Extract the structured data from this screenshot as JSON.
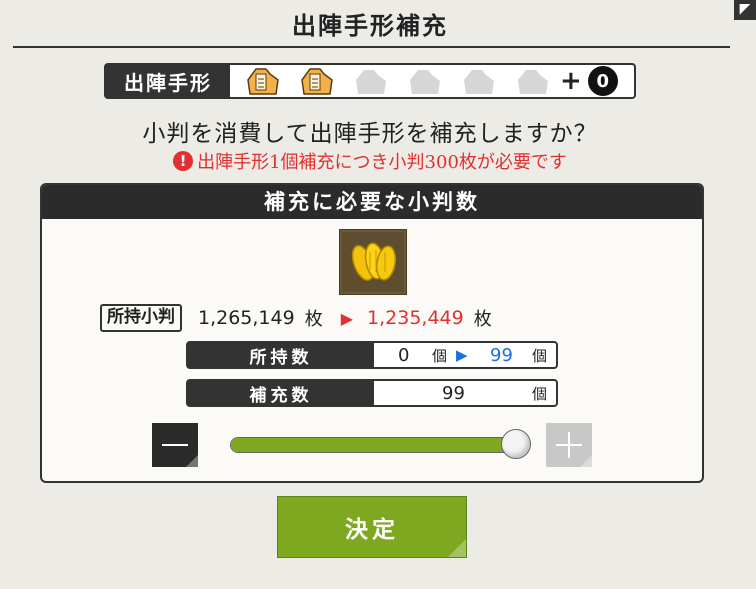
{
  "header": {
    "title": "出陣手形補充"
  },
  "pass_bar": {
    "label": "出陣手形",
    "slots": [
      {
        "icon": "pass-token-filled-icon",
        "filled": true
      },
      {
        "icon": "pass-token-filled-icon",
        "filled": true
      },
      {
        "icon": "pass-token-empty-icon",
        "filled": false
      },
      {
        "icon": "pass-token-empty-icon",
        "filled": false
      },
      {
        "icon": "pass-token-empty-icon",
        "filled": false
      },
      {
        "icon": "pass-token-empty-icon",
        "filled": false
      }
    ],
    "plus": "+",
    "extra_count": "0"
  },
  "question": "小判を消費して出陣手形を補充しますか？",
  "warning": {
    "icon": "!",
    "text": "出陣手形1個補充につき小判300枚が必要です"
  },
  "panel": {
    "title": "補充に必要な小判数",
    "item_icon": "koban-gold-coins-icon",
    "owned_koban": {
      "label": "所持小判",
      "current": "1,265,149",
      "unit": "枚",
      "after": "1,235,449"
    },
    "owned_count": {
      "label": "所持数",
      "current": "0",
      "unit": "個",
      "after": "99"
    },
    "refill_count": {
      "label": "補充数",
      "value": "99",
      "unit": "個"
    },
    "slider": {
      "level": 1.0
    }
  },
  "confirm_label": "決定",
  "colors": {
    "accent_green": "#7ea820",
    "warning_red": "#e23030",
    "after_blue": "#1c6fe0",
    "dark": "#2b2b2b"
  }
}
